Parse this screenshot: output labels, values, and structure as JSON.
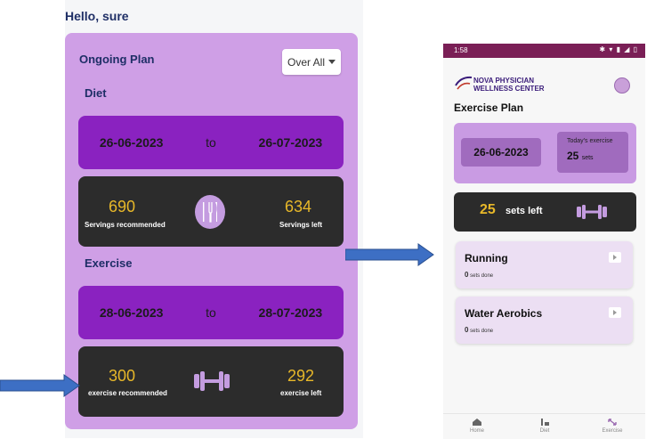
{
  "left": {
    "greeting": "Hello, sure",
    "ongoing_title": "Ongoing Plan",
    "dropdown_value": "Over All",
    "diet": {
      "title": "Diet",
      "start": "26-06-2023",
      "to": "to",
      "end": "26-07-2023",
      "recommended_value": "690",
      "recommended_label": "Servings recommended",
      "left_value": "634",
      "left_label": "Servings left",
      "icon": "cutlery-icon"
    },
    "exercise": {
      "title": "Exercise",
      "start": "28-06-2023",
      "to": "to",
      "end": "28-07-2023",
      "recommended_value": "300",
      "recommended_label": "exercise recommended",
      "left_value": "292",
      "left_label": "exercise left",
      "icon": "dumbbell-icon"
    }
  },
  "right": {
    "status": {
      "time": "1:58",
      "icons": "✱ ▾ ▮ ◢ ▯"
    },
    "logo": {
      "line1": "NOVA PHYSICIAN",
      "line2": "WELLNESS CENTER"
    },
    "title": "Exercise Plan",
    "plan": {
      "date": "26-06-2023",
      "today_label": "Today's exercise",
      "today_value": "25",
      "today_unit": "sets"
    },
    "sets_left": {
      "value": "25",
      "label": "sets left"
    },
    "exercises": [
      {
        "name": "Running",
        "done_value": "0",
        "done_label": "sets done"
      },
      {
        "name": "Water Aerobics",
        "done_value": "0",
        "done_label": "sets done"
      }
    ],
    "nav": [
      {
        "label": "Home",
        "icon": "home-icon"
      },
      {
        "label": "Diet",
        "icon": "diet-icon"
      },
      {
        "label": "Exercise",
        "icon": "exercise-icon"
      }
    ]
  },
  "colors": {
    "panel": "#cf9fe6",
    "date_bar": "#8a22c0",
    "card_dark": "#2c2c2c",
    "accent_yellow": "#e8b829",
    "status_bar": "#7a1f56",
    "arrow": "#3d6fc4"
  }
}
